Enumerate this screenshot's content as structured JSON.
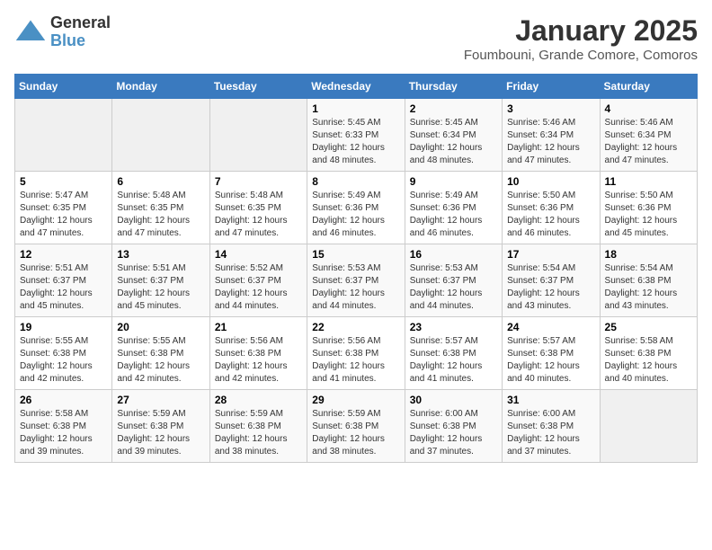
{
  "logo": {
    "general": "General",
    "blue": "Blue"
  },
  "header": {
    "month": "January 2025",
    "location": "Foumbouni, Grande Comore, Comoros"
  },
  "weekdays": [
    "Sunday",
    "Monday",
    "Tuesday",
    "Wednesday",
    "Thursday",
    "Friday",
    "Saturday"
  ],
  "weeks": [
    [
      {
        "day": "",
        "info": ""
      },
      {
        "day": "",
        "info": ""
      },
      {
        "day": "",
        "info": ""
      },
      {
        "day": "1",
        "info": "Sunrise: 5:45 AM\nSunset: 6:33 PM\nDaylight: 12 hours\nand 48 minutes."
      },
      {
        "day": "2",
        "info": "Sunrise: 5:45 AM\nSunset: 6:34 PM\nDaylight: 12 hours\nand 48 minutes."
      },
      {
        "day": "3",
        "info": "Sunrise: 5:46 AM\nSunset: 6:34 PM\nDaylight: 12 hours\nand 47 minutes."
      },
      {
        "day": "4",
        "info": "Sunrise: 5:46 AM\nSunset: 6:34 PM\nDaylight: 12 hours\nand 47 minutes."
      }
    ],
    [
      {
        "day": "5",
        "info": "Sunrise: 5:47 AM\nSunset: 6:35 PM\nDaylight: 12 hours\nand 47 minutes."
      },
      {
        "day": "6",
        "info": "Sunrise: 5:48 AM\nSunset: 6:35 PM\nDaylight: 12 hours\nand 47 minutes."
      },
      {
        "day": "7",
        "info": "Sunrise: 5:48 AM\nSunset: 6:35 PM\nDaylight: 12 hours\nand 47 minutes."
      },
      {
        "day": "8",
        "info": "Sunrise: 5:49 AM\nSunset: 6:36 PM\nDaylight: 12 hours\nand 46 minutes."
      },
      {
        "day": "9",
        "info": "Sunrise: 5:49 AM\nSunset: 6:36 PM\nDaylight: 12 hours\nand 46 minutes."
      },
      {
        "day": "10",
        "info": "Sunrise: 5:50 AM\nSunset: 6:36 PM\nDaylight: 12 hours\nand 46 minutes."
      },
      {
        "day": "11",
        "info": "Sunrise: 5:50 AM\nSunset: 6:36 PM\nDaylight: 12 hours\nand 45 minutes."
      }
    ],
    [
      {
        "day": "12",
        "info": "Sunrise: 5:51 AM\nSunset: 6:37 PM\nDaylight: 12 hours\nand 45 minutes."
      },
      {
        "day": "13",
        "info": "Sunrise: 5:51 AM\nSunset: 6:37 PM\nDaylight: 12 hours\nand 45 minutes."
      },
      {
        "day": "14",
        "info": "Sunrise: 5:52 AM\nSunset: 6:37 PM\nDaylight: 12 hours\nand 44 minutes."
      },
      {
        "day": "15",
        "info": "Sunrise: 5:53 AM\nSunset: 6:37 PM\nDaylight: 12 hours\nand 44 minutes."
      },
      {
        "day": "16",
        "info": "Sunrise: 5:53 AM\nSunset: 6:37 PM\nDaylight: 12 hours\nand 44 minutes."
      },
      {
        "day": "17",
        "info": "Sunrise: 5:54 AM\nSunset: 6:37 PM\nDaylight: 12 hours\nand 43 minutes."
      },
      {
        "day": "18",
        "info": "Sunrise: 5:54 AM\nSunset: 6:38 PM\nDaylight: 12 hours\nand 43 minutes."
      }
    ],
    [
      {
        "day": "19",
        "info": "Sunrise: 5:55 AM\nSunset: 6:38 PM\nDaylight: 12 hours\nand 42 minutes."
      },
      {
        "day": "20",
        "info": "Sunrise: 5:55 AM\nSunset: 6:38 PM\nDaylight: 12 hours\nand 42 minutes."
      },
      {
        "day": "21",
        "info": "Sunrise: 5:56 AM\nSunset: 6:38 PM\nDaylight: 12 hours\nand 42 minutes."
      },
      {
        "day": "22",
        "info": "Sunrise: 5:56 AM\nSunset: 6:38 PM\nDaylight: 12 hours\nand 41 minutes."
      },
      {
        "day": "23",
        "info": "Sunrise: 5:57 AM\nSunset: 6:38 PM\nDaylight: 12 hours\nand 41 minutes."
      },
      {
        "day": "24",
        "info": "Sunrise: 5:57 AM\nSunset: 6:38 PM\nDaylight: 12 hours\nand 40 minutes."
      },
      {
        "day": "25",
        "info": "Sunrise: 5:58 AM\nSunset: 6:38 PM\nDaylight: 12 hours\nand 40 minutes."
      }
    ],
    [
      {
        "day": "26",
        "info": "Sunrise: 5:58 AM\nSunset: 6:38 PM\nDaylight: 12 hours\nand 39 minutes."
      },
      {
        "day": "27",
        "info": "Sunrise: 5:59 AM\nSunset: 6:38 PM\nDaylight: 12 hours\nand 39 minutes."
      },
      {
        "day": "28",
        "info": "Sunrise: 5:59 AM\nSunset: 6:38 PM\nDaylight: 12 hours\nand 38 minutes."
      },
      {
        "day": "29",
        "info": "Sunrise: 5:59 AM\nSunset: 6:38 PM\nDaylight: 12 hours\nand 38 minutes."
      },
      {
        "day": "30",
        "info": "Sunrise: 6:00 AM\nSunset: 6:38 PM\nDaylight: 12 hours\nand 37 minutes."
      },
      {
        "day": "31",
        "info": "Sunrise: 6:00 AM\nSunset: 6:38 PM\nDaylight: 12 hours\nand 37 minutes."
      },
      {
        "day": "",
        "info": ""
      }
    ]
  ]
}
